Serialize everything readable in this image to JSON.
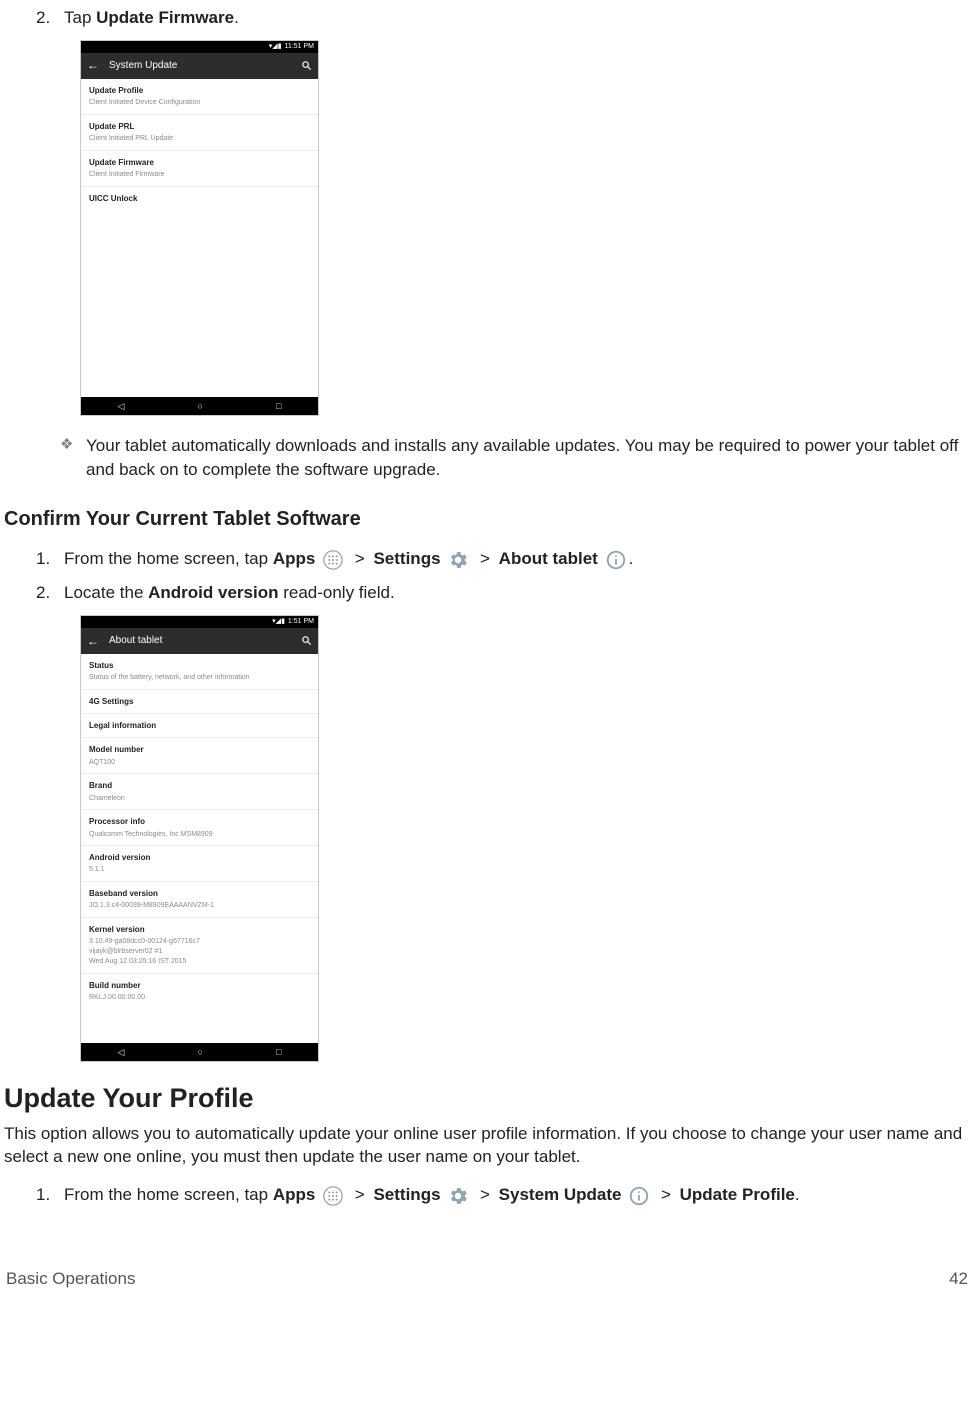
{
  "step2": {
    "num": "2.",
    "pre": "Tap ",
    "bold": "Update Firmware",
    "post": "."
  },
  "phone1": {
    "time": "11:51 PM",
    "title": "System Update",
    "rows": [
      {
        "t": "Update Profile",
        "s": "Client Initiated Device Configuration"
      },
      {
        "t": "Update PRL",
        "s": "Client Initiated PRL Update"
      },
      {
        "t": "Update Firmware",
        "s": "Client Initiated Firmware"
      },
      {
        "t": "UICC Unlock",
        "s": ""
      }
    ]
  },
  "bullet1": "Your tablet automatically downloads and installs any available updates. You may be required to power your tablet off and back on to complete the software upgrade.",
  "sectionA": "Confirm Your Current Tablet Software",
  "confirm1": {
    "num": "1.",
    "pre": "From the home screen, tap ",
    "apps": "Apps",
    "gt": ">",
    "settings": "Settings",
    "about": "About tablet",
    "post": "."
  },
  "confirm2": {
    "num": "2.",
    "pre": "Locate the ",
    "bold": "Android version",
    "post": " read-only field."
  },
  "phone2": {
    "time": "1:51 PM",
    "title": "About tablet",
    "rows": [
      {
        "t": "Status",
        "s": "Status of the battery, network, and other information"
      },
      {
        "t": "4G Settings",
        "s": ""
      },
      {
        "t": "Legal information",
        "s": ""
      },
      {
        "t": "Model number",
        "s": "AQT100"
      },
      {
        "t": "Brand",
        "s": "Chameleon"
      },
      {
        "t": "Processor info",
        "s": "Qualcomm Technologies, Inc MSM8909"
      },
      {
        "t": "Android version",
        "s": "5.1.1"
      },
      {
        "t": "Baseband version",
        "s": "JO.1.3.c4-00039-M8909EAAAANVZM-1"
      },
      {
        "t": "Kernel version",
        "s": "3.10.49-ga08dcc0-00124-g67716c7\nvijayk@blrbserver02 #1\nWed Aug 12 03:25:16 IST 2015"
      },
      {
        "t": "Build number",
        "s": "RKLJ.00.00.00.00"
      }
    ]
  },
  "sectionB": "Update Your Profile",
  "paraB": "This option allows you to automatically update your online user profile information. If you choose to change your user name and select a new one online, you must then update the user name on your tablet.",
  "update1": {
    "num": "1.",
    "pre": "From the home screen, tap ",
    "apps": "Apps",
    "gt": ">",
    "settings": "Settings",
    "sysupdate": "System Update",
    "updprofile": "Update Profile",
    "post": "."
  },
  "footer": {
    "left": "Basic Operations",
    "right": "42"
  },
  "nav": {
    "back": "◁",
    "home": "○",
    "recent": "□"
  },
  "status_icons": "▾◢▮"
}
